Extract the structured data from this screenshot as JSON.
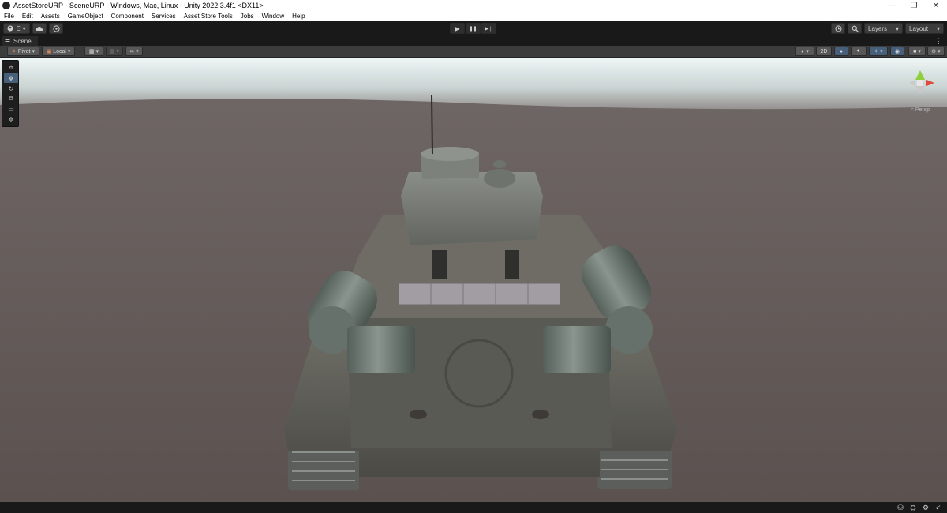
{
  "window": {
    "title": "AssetStoreURP - SceneURP - Windows, Mac, Linux - Unity 2022.3.4f1 <DX11>",
    "minimize_glyph": "—",
    "restore_glyph": "❐",
    "close_glyph": "✕"
  },
  "menu": [
    "File",
    "Edit",
    "Assets",
    "GameObject",
    "Component",
    "Services",
    "Asset Store Tools",
    "Jobs",
    "Window",
    "Help"
  ],
  "toolbar": {
    "account_label": "E",
    "cloud_icon": "cloud-icon",
    "collab_icon": "collab-icon",
    "play_glyph": "▶",
    "pause_glyph": "❚❚",
    "step_glyph": "▶❘",
    "history_icon": "history-icon",
    "search_icon": "search-icon",
    "layers_label": "Layers",
    "layout_label": "Layout",
    "dropdown_glyph": "▾"
  },
  "tab": {
    "label": "Scene",
    "menu_glyph": "⋮"
  },
  "scene_toolbar": {
    "pivot_label": "Pivot",
    "local_label": "Local",
    "mode_2d_label": "2D"
  },
  "tools": [
    "hand",
    "move",
    "rotate",
    "scale",
    "rect",
    "transform"
  ],
  "gizmo": {
    "label": "< Persp"
  },
  "colors": {
    "editor_bg": "#191919",
    "panel_bg": "#3c3c3c",
    "accent": "#46607c",
    "sky_top": "#eef6f6",
    "ground": "#615856"
  }
}
